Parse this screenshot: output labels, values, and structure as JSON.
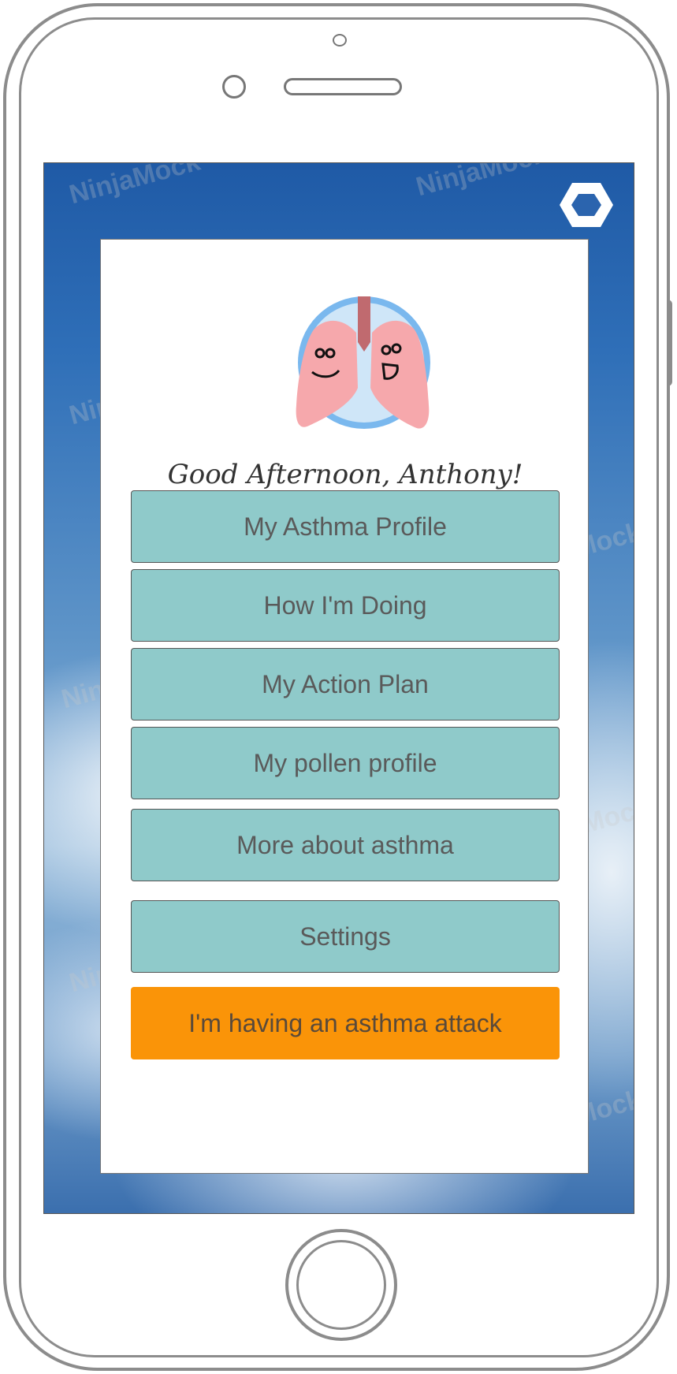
{
  "greeting": "Good Afternoon, Anthony!",
  "menu": [
    {
      "label": "My Asthma Profile"
    },
    {
      "label": "How I'm Doing"
    },
    {
      "label": "My Action Plan"
    },
    {
      "label": "My pollen profile"
    },
    {
      "label": "More about asthma"
    },
    {
      "label": "Settings"
    },
    {
      "label": "I'm having an asthma attack"
    }
  ],
  "watermark": "NinjaMock",
  "colors": {
    "menu_button": "#8fcaca",
    "attack_button": "#fa9408",
    "card": "#ffffff",
    "sky_top": "#1f5aa6"
  },
  "icons": {
    "settings": "hexagon-icon",
    "logo": "smiling-lungs-icon"
  }
}
